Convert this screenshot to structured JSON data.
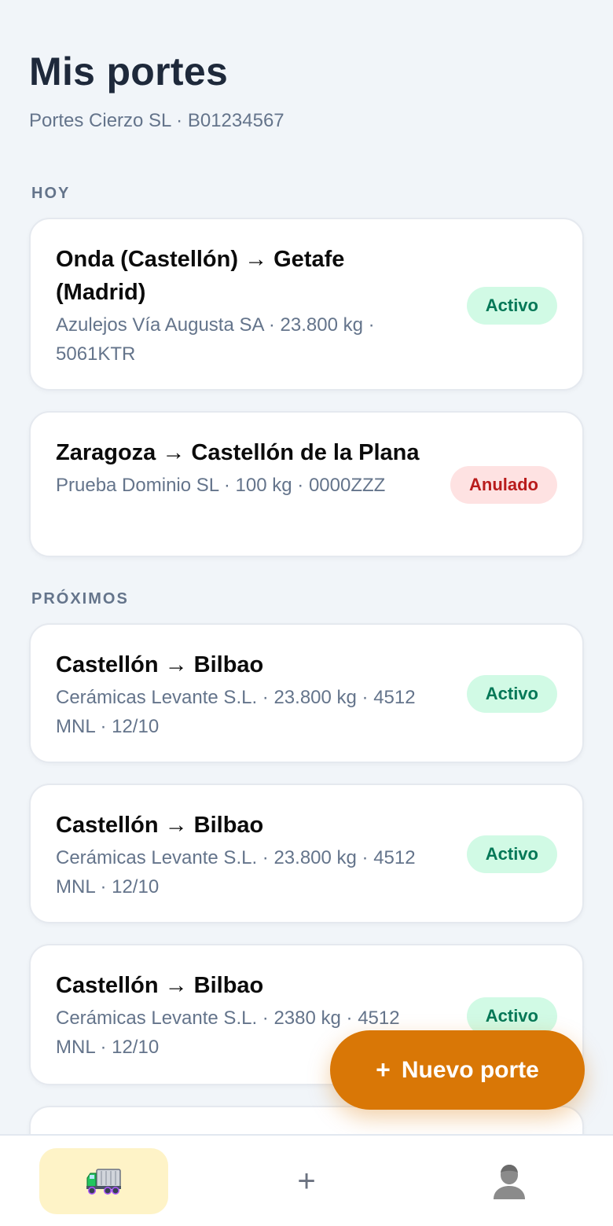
{
  "header": {
    "title": "Mis portes",
    "subtitle": "Portes Cierzo SL · B01234567"
  },
  "sections": [
    {
      "label": "HOY",
      "items": [
        {
          "route": "Onda (Castellón) → Getafe (Madrid)",
          "meta": "Azulejos Vía Augusta SA · 23.800 kg · 5061KTR",
          "status": "Activo"
        },
        {
          "route": "Zaragoza → Castellón de la Plana",
          "meta": "Prueba Dominio SL · 100 kg · 0000ZZZ",
          "status": "Anulado"
        }
      ]
    },
    {
      "label": "PRÓXIMOS",
      "items": [
        {
          "route": "Castellón → Bilbao",
          "meta": "Cerámicas Levante S.L. · 23.800 kg · 4512 MNL · 12/10",
          "status": "Activo"
        },
        {
          "route": "Castellón → Bilbao",
          "meta": "Cerámicas Levante S.L. · 23.800 kg · 4512 MNL · 12/10",
          "status": "Activo"
        },
        {
          "route": "Castellón → Bilbao",
          "meta": "Cerámicas Levante S.L. · 2380 kg · 4512 MNL · 12/10",
          "status": "Activo"
        }
      ]
    }
  ],
  "fab": {
    "icon": "+",
    "label": "Nuevo porte"
  },
  "bottom_nav": {
    "items": [
      {
        "icon": "truck-icon",
        "active": true
      },
      {
        "icon": "+",
        "active": false
      },
      {
        "icon": "user-icon",
        "active": false
      }
    ]
  },
  "colors": {
    "accent": "#d97706",
    "active_bg": "#d1fae5",
    "active_text": "#047857",
    "cancelled_bg": "#fee2e2",
    "cancelled_text": "#b91c1c",
    "nav_active_bg": "#fef3c7"
  }
}
